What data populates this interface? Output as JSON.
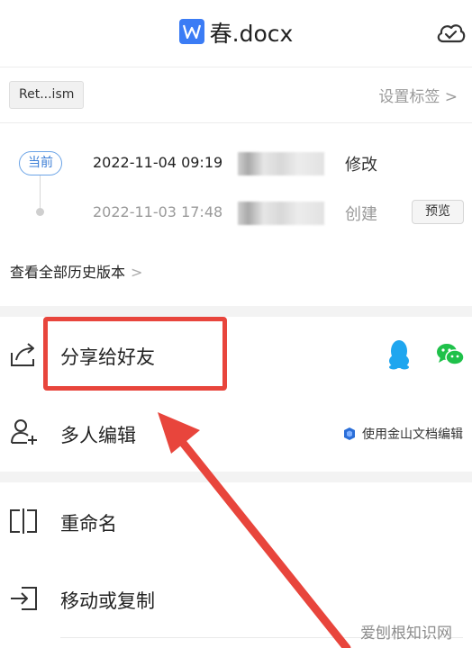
{
  "header": {
    "title": "春.docx",
    "doc_icon": "word-doc-icon",
    "cloud_icon": "cloud-sync-icon"
  },
  "tags": {
    "chip": "Ret...ism",
    "set_tag": "设置标签 >"
  },
  "history": {
    "current_badge": "当前",
    "entries": [
      {
        "time": "2022-11-04 09:19",
        "action": "修改"
      },
      {
        "time": "2022-11-03 17:48",
        "action": "创建",
        "button": "预览"
      }
    ],
    "view_all": "查看全部历史版本",
    "view_all_chevron": ">"
  },
  "actions": {
    "share": {
      "label": "分享给好友",
      "icon": "share-icon",
      "targets": [
        "qq-icon",
        "wechat-icon"
      ]
    },
    "multi_edit": {
      "label": "多人编辑",
      "icon": "add-user-icon",
      "hint": "使用金山文档编辑"
    },
    "rename": {
      "label": "重命名",
      "icon": "rename-icon"
    },
    "move_copy": {
      "label": "移动或复制",
      "icon": "move-icon"
    }
  },
  "annotation": {
    "color": "#e8453c"
  },
  "watermark": "爱刨根知识网",
  "colors": {
    "accent": "#3b7cf5",
    "qq": "#1fa6ef",
    "wechat": "#1fc14a",
    "annotation": "#e8453c"
  }
}
